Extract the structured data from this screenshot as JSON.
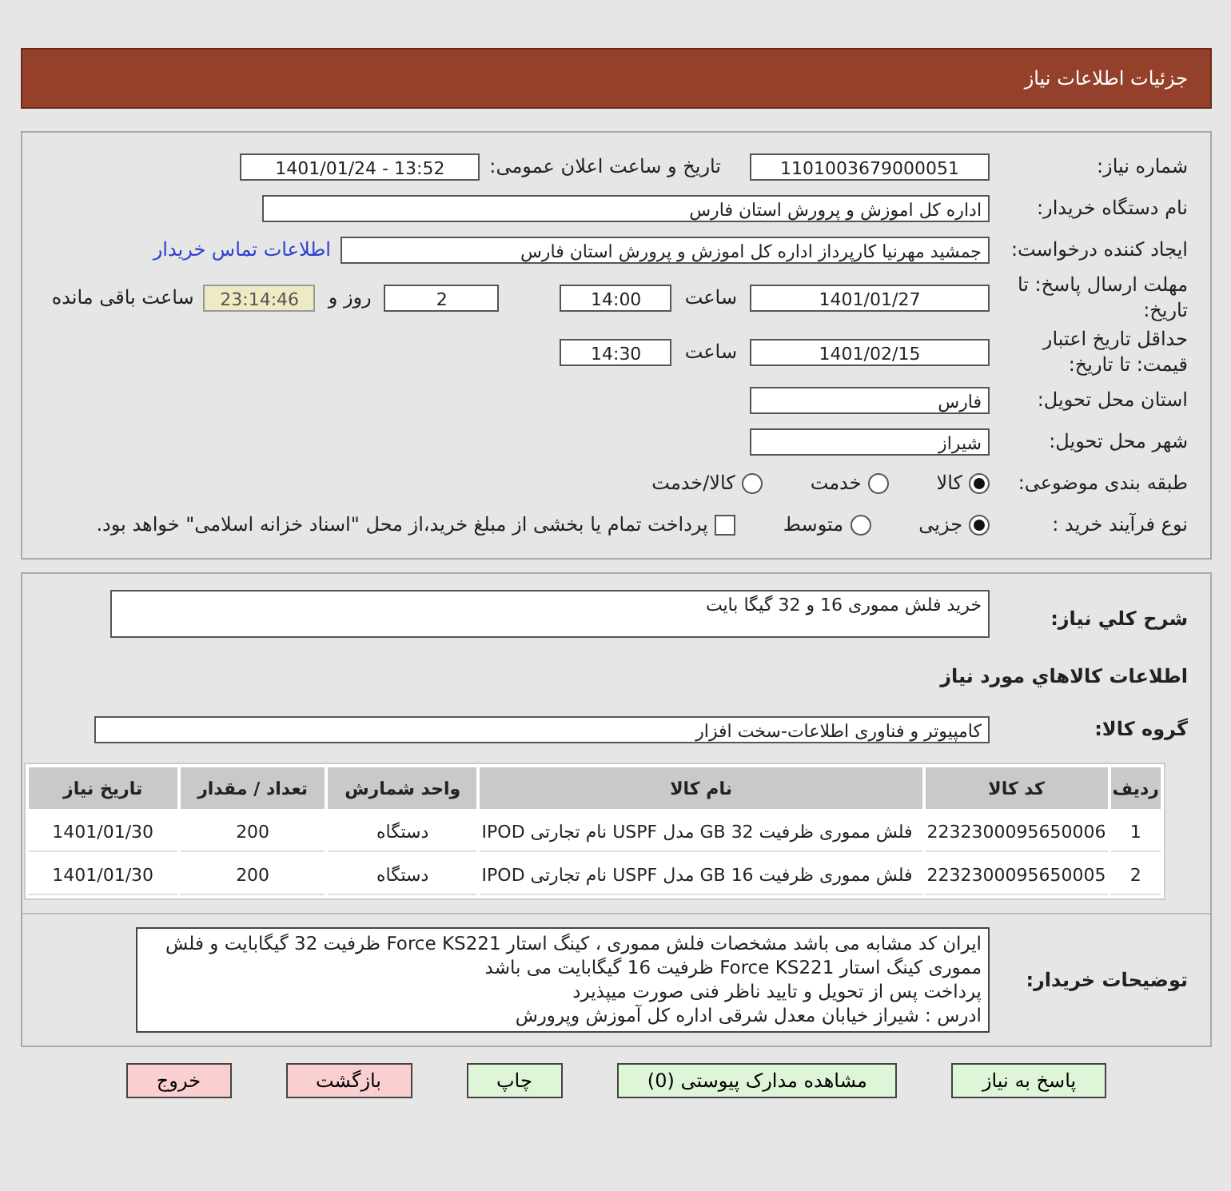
{
  "title": "جزئیات اطلاعات نیاز",
  "need_number": {
    "label": "شماره نیاز:",
    "value": "1101003679000051"
  },
  "announce": {
    "label": "تاریخ و ساعت اعلان عمومی:",
    "value": "1401/01/24 - 13:52"
  },
  "buyer": {
    "label": "نام دستگاه خریدار:",
    "value": "اداره کل اموزش و پرورش استان فارس"
  },
  "requester": {
    "label": "ایجاد کننده درخواست:",
    "value": "جمشید مهرنیا کارپرداز اداره کل اموزش و پرورش استان فارس",
    "link": "اطلاعات تماس خریدار"
  },
  "deadline": {
    "label": "مهلت ارسال پاسخ: تا تاریخ:",
    "date": "1401/01/27",
    "time_label": "ساعت",
    "time": "14:00",
    "days": "2",
    "days_label": "روز و",
    "remaining": "23:14:46",
    "remaining_label": "ساعت باقی مانده"
  },
  "validity": {
    "label": "حداقل تاریخ اعتبار قیمت: تا تاریخ:",
    "date": "1401/02/15",
    "time_label": "ساعت",
    "time": "14:30"
  },
  "province": {
    "label": "استان محل تحویل:",
    "value": "فارس"
  },
  "city": {
    "label": "شهر محل تحویل:",
    "value": "شیراز"
  },
  "category": {
    "label": "طبقه بندی موضوعی:",
    "options": [
      {
        "label": "کالا",
        "selected": true
      },
      {
        "label": "خدمت",
        "selected": false
      },
      {
        "label": "کالا/خدمت",
        "selected": false
      }
    ]
  },
  "process": {
    "label": "نوع فرآیند خرید :",
    "options": [
      {
        "label": "جزیی",
        "selected": true
      },
      {
        "label": "متوسط",
        "selected": false
      }
    ],
    "payment": {
      "checked": false,
      "text": "پرداخت تمام یا بخشی از مبلغ خرید،از محل \"اسناد خزانه اسلامی\" خواهد بود."
    }
  },
  "summary": {
    "label": "شرح کلي نياز:",
    "value": "خرید فلش مموری 16 و 32 گیگا بایت"
  },
  "goods_heading": "اطلاعات کالاهاي مورد نياز",
  "group": {
    "label": "گروه کالا:",
    "value": "کامپیوتر و فناوری اطلاعات-سخت افزار"
  },
  "table": {
    "columns": [
      "ردیف",
      "کد کالا",
      "نام کالا",
      "واحد شمارش",
      "تعداد / مقدار",
      "تاریخ نیاز"
    ],
    "rows": [
      [
        "1",
        "2232300095650006",
        "فلش مموری ظرفیت 32 GB مدل USPF نام تجارتی IPOD",
        "دستگاه",
        "200",
        "1401/01/30"
      ],
      [
        "2",
        "2232300095650005",
        "فلش مموری ظرفیت 16 GB مدل USPF نام تجارتی IPOD",
        "دستگاه",
        "200",
        "1401/01/30"
      ]
    ]
  },
  "notes": {
    "label": "توضیحات خریدار:",
    "lines": [
      "ایران کد مشابه می باشد مشخصات فلش مموری ، کینگ استار Force KS221 ظرفیت 32 گیگابایت و فلش مموری کینگ استار Force KS221 ظرفیت 16 گیگابایت می باشد",
      "پرداخت پس از تحویل و تایید ناظر فنی صورت میپذیرد",
      "ادرس : شیراز خیابان معدل شرقی اداره کل آموزش وپرورش"
    ]
  },
  "buttons": [
    {
      "label": "پاسخ به نیاز",
      "kind": "normal"
    },
    {
      "label": "مشاهده مدارک پیوستی (0)",
      "kind": "normal"
    },
    {
      "label": "چاپ",
      "kind": "normal"
    },
    {
      "label": "بازگشت",
      "kind": "danger"
    },
    {
      "label": "خروج",
      "kind": "danger"
    }
  ]
}
